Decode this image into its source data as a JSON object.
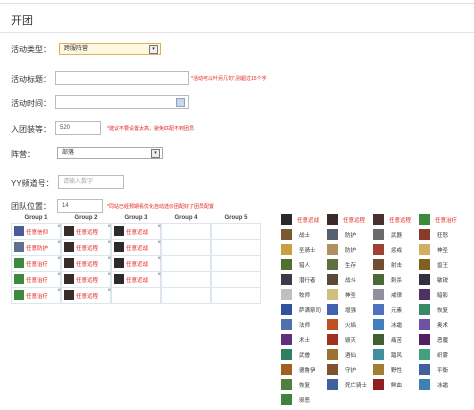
{
  "page": {
    "title": "开团"
  },
  "form": {
    "activity_type": {
      "label": "活动类型：",
      "value": "跨服阵营"
    },
    "activity_title": {
      "label": "活动标题：",
      "hint": "*活动可以叶另几句“,别超过15个字"
    },
    "activity_time": {
      "label": "活动时间："
    },
    "gear_score": {
      "label": "入团装等：",
      "value": "520",
      "hint": "*建议不要设置太高，避免匹配不到团员"
    },
    "faction": {
      "label": "阵营：",
      "value": "部落"
    },
    "yy": {
      "label": "YY频道号：",
      "placeholder": "请输入数字"
    },
    "team_pos": {
      "label": "团队位置：",
      "value": "14",
      "hint": "*同站已经预期看优化自动选价团配好了团员配置"
    }
  },
  "groups": [
    {
      "name": "Group 1",
      "slots": [
        {
          "text": "任意信仰",
          "icon": "crossed-swords-icon",
          "color": "#4a5a9a"
        },
        {
          "text": "任意防护",
          "icon": "shield-icon",
          "color": "#607090"
        },
        {
          "text": "任意治疗",
          "icon": "plus-icon",
          "color": "#3c8a3c"
        },
        {
          "text": "任意治疗",
          "icon": "plus-icon",
          "color": "#3c8a3c"
        },
        {
          "text": "任意治疗",
          "icon": "plus-icon",
          "color": "#3c8a3c"
        }
      ]
    },
    {
      "name": "Group 2",
      "slots": [
        {
          "text": "任意远程",
          "icon": "fire-arc-icon",
          "color": "#3a2a2a"
        },
        {
          "text": "任意远程",
          "icon": "fire-arc-icon",
          "color": "#3a2a2a"
        },
        {
          "text": "任意远程",
          "icon": "fire-arc-icon",
          "color": "#3a2a2a"
        },
        {
          "text": "任意远程",
          "icon": "fire-arc-icon",
          "color": "#3a2a2a"
        },
        {
          "text": "任意远程",
          "icon": "fire-arc-icon",
          "color": "#3a2a2a"
        }
      ]
    },
    {
      "name": "Group 3",
      "slots": [
        {
          "text": "任意近战",
          "icon": "sword-icon",
          "color": "#2a2a2a"
        },
        {
          "text": "任意近战",
          "icon": "sword-icon",
          "color": "#2a2a2a"
        },
        {
          "text": "任意近战",
          "icon": "sword-icon",
          "color": "#2a2a2a"
        },
        {
          "text": "任意近战",
          "icon": "sword-icon",
          "color": "#2a2a2a"
        },
        {
          "text": "",
          "icon": "",
          "color": ""
        }
      ]
    },
    {
      "name": "Group 4",
      "slots": []
    },
    {
      "name": "Group 5",
      "slots": []
    }
  ],
  "roles": [
    {
      "text": "任意近战",
      "red": true,
      "color": "#2a2a2a"
    },
    {
      "text": "任意远程",
      "red": true,
      "color": "#3a2a2a"
    },
    {
      "text": "任意远程",
      "red": true,
      "color": "#4a3030"
    },
    {
      "text": "任意治疗",
      "red": true,
      "color": "#3c8a3c"
    },
    {
      "text": "战士",
      "color": "#7a5a30"
    },
    {
      "text": "防护",
      "color": "#556070"
    },
    {
      "text": "武器",
      "color": "#6a6a6a"
    },
    {
      "text": "狂怒",
      "color": "#8a3a2a"
    },
    {
      "text": "圣骑士",
      "color": "#c8a040"
    },
    {
      "text": "防护",
      "color": "#b09060"
    },
    {
      "text": "惩戒",
      "color": "#a04030"
    },
    {
      "text": "神圣",
      "color": "#d0b060"
    },
    {
      "text": "猎人",
      "color": "#507030"
    },
    {
      "text": "生存",
      "color": "#607040"
    },
    {
      "text": "射击",
      "color": "#705030"
    },
    {
      "text": "兽王",
      "color": "#806020"
    },
    {
      "text": "潜行者",
      "color": "#3a3a4a"
    },
    {
      "text": "战斗",
      "color": "#5a4a3a"
    },
    {
      "text": "刺杀",
      "color": "#4a6a3a"
    },
    {
      "text": "敏锐",
      "color": "#303040"
    },
    {
      "text": "牧师",
      "color": "#c0c0c0"
    },
    {
      "text": "神圣",
      "color": "#d0c080"
    },
    {
      "text": "戒律",
      "color": "#9090a0"
    },
    {
      "text": "暗影",
      "color": "#503060"
    },
    {
      "text": "萨满祭司",
      "color": "#3050a0"
    },
    {
      "text": "增强",
      "color": "#4060b0"
    },
    {
      "text": "元素",
      "color": "#5070c0"
    },
    {
      "text": "恢复",
      "color": "#3a8a6a"
    },
    {
      "text": "法师",
      "color": "#5070b0"
    },
    {
      "text": "火焰",
      "color": "#c05020"
    },
    {
      "text": "冰霜",
      "color": "#4080c0"
    },
    {
      "text": "奥术",
      "color": "#7050a0"
    },
    {
      "text": "术士",
      "color": "#603080"
    },
    {
      "text": "毁灭",
      "color": "#a03020"
    },
    {
      "text": "痛苦",
      "color": "#406030"
    },
    {
      "text": "恶魔",
      "color": "#502060"
    },
    {
      "text": "武僧",
      "color": "#308060"
    },
    {
      "text": "酒仙",
      "color": "#a07030"
    },
    {
      "text": "踏风",
      "color": "#4090a0"
    },
    {
      "text": "织雾",
      "color": "#40a080"
    },
    {
      "text": "德鲁伊",
      "color": "#a06020"
    },
    {
      "text": "守护",
      "color": "#805030"
    },
    {
      "text": "野性",
      "color": "#a08030"
    },
    {
      "text": "平衡",
      "color": "#4060a0"
    },
    {
      "text": "恢复",
      "color": "#508040"
    },
    {
      "text": "死亡骑士",
      "color": "#4060a0"
    },
    {
      "text": "鲜血",
      "color": "#902020"
    },
    {
      "text": "冰霜",
      "color": "#4080b0"
    },
    {
      "text": "邪恶",
      "color": "#408040"
    }
  ]
}
